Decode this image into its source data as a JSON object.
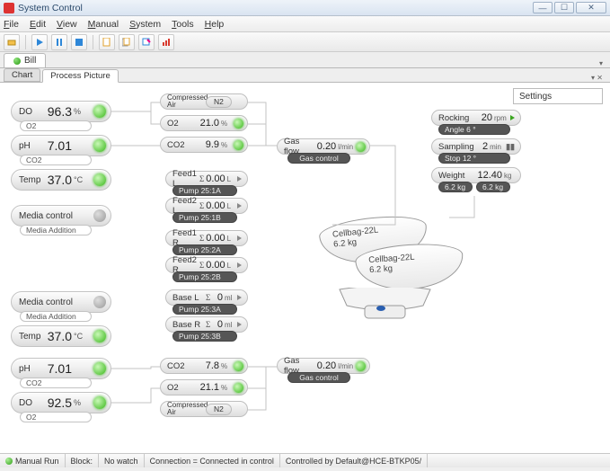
{
  "window": {
    "title": "System Control"
  },
  "menu": {
    "file": "File",
    "edit": "Edit",
    "view": "View",
    "manual": "Manual",
    "system": "System",
    "tools": "Tools",
    "help": "Help"
  },
  "doc_tab": "Bill",
  "tabs": {
    "chart": "Chart",
    "process": "Process Picture"
  },
  "settings_btn": "Settings",
  "left": {
    "do1": {
      "label": "DO",
      "value": "96.3",
      "unit": "%",
      "sub": "O2"
    },
    "ph1": {
      "label": "pH",
      "value": "7.01",
      "unit": "",
      "sub": "CO2"
    },
    "temp1": {
      "label": "Temp",
      "value": "37.0",
      "unit": "°C"
    },
    "media1": {
      "label": "Media control",
      "sub": "Media Addition"
    },
    "media2": {
      "label": "Media control",
      "sub": "Media Addition"
    },
    "temp2": {
      "label": "Temp",
      "value": "37.0",
      "unit": "°C"
    },
    "ph2": {
      "label": "pH",
      "value": "7.01",
      "unit": "",
      "sub": "CO2"
    },
    "do2": {
      "label": "DO",
      "value": "92.5",
      "unit": "%",
      "sub": "O2"
    }
  },
  "gas": {
    "comp1": {
      "label": "Compressed Air",
      "btn": "N2"
    },
    "o2_1": {
      "label": "O2",
      "value": "21.0",
      "unit": "%"
    },
    "co2_1": {
      "label": "CO2",
      "value": "9.9",
      "unit": "%"
    },
    "flow1": {
      "label": "Gas flow",
      "value": "0.20",
      "unit": "l/min",
      "sub": "Gas control"
    },
    "co2_2": {
      "label": "CO2",
      "value": "7.8",
      "unit": "%"
    },
    "o2_2": {
      "label": "O2",
      "value": "21.1",
      "unit": "%"
    },
    "comp2": {
      "label": "Compressed Air",
      "btn": "N2"
    },
    "flow2": {
      "label": "Gas flow",
      "value": "0.20",
      "unit": "l/min",
      "sub": "Gas control"
    }
  },
  "feeds": {
    "f1l": {
      "label": "Feed1 L",
      "value": "0.00",
      "unit": "L",
      "sub": "Pump 25:1A"
    },
    "f2l": {
      "label": "Feed2 L",
      "value": "0.00",
      "unit": "L",
      "sub": "Pump 25:1B"
    },
    "f1r": {
      "label": "Feed1 R",
      "value": "0.00",
      "unit": "L",
      "sub": "Pump 25:2A"
    },
    "f2r": {
      "label": "Feed2 R",
      "value": "0.00",
      "unit": "L",
      "sub": "Pump 25:2B"
    },
    "bl": {
      "label": "Base L",
      "value": "0",
      "unit": "ml",
      "sub": "Pump 25:3A"
    },
    "br": {
      "label": "Base R",
      "value": "0",
      "unit": "ml",
      "sub": "Pump 25:3B"
    }
  },
  "right": {
    "rocking": {
      "label": "Rocking",
      "value": "20",
      "unit": "rpm",
      "sub": "Angle 6 °"
    },
    "sampling": {
      "label": "Sampling",
      "value": "2",
      "unit": "min",
      "sub": "Stop 12 °"
    },
    "weight": {
      "label": "Weight",
      "value": "12.40",
      "unit": "kg",
      "sub_l": "6.2 kg",
      "sub_r": "6.2 kg"
    }
  },
  "bags": {
    "b1": {
      "name": "Cellbag-22L",
      "wt": "6.2 kg"
    },
    "b2": {
      "name": "Cellbag-22L",
      "wt": "6.2 kg"
    }
  },
  "status": {
    "run": "Manual Run",
    "block": "Block:",
    "watch": "No watch",
    "conn": "Connection = Connected in control",
    "ctrl": "Controlled by Default@HCE-BTKP05/"
  }
}
